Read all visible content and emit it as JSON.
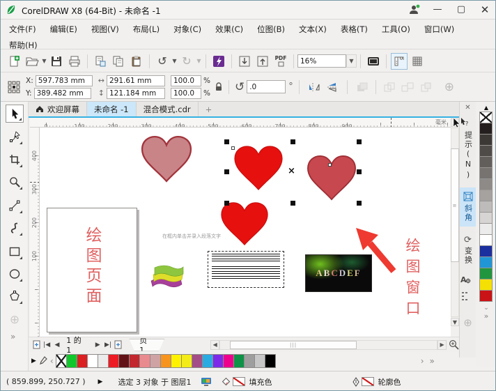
{
  "window": {
    "title": "CorelDRAW X8 (64-Bit) - 未命名 -1"
  },
  "menu": {
    "row1": [
      "文件(F)",
      "编辑(E)",
      "视图(V)",
      "布局(L)",
      "对象(C)",
      "效果(C)",
      "位图(B)",
      "文本(X)",
      "表格(T)",
      "工具(O)",
      "窗口(W)"
    ],
    "row2": [
      "帮助(H)"
    ]
  },
  "toolbar": {
    "zoom_value": "16%",
    "pdf": "PDF"
  },
  "props": {
    "x_label": "X:",
    "y_label": "Y:",
    "x": "597.783 mm",
    "y": "389.482 mm",
    "w": "291.61 mm",
    "h": "121.184 mm",
    "sx": "100.0",
    "sy": "100.0",
    "pct": "%",
    "angle": ".0",
    "deg": "°"
  },
  "tabs": {
    "items": [
      "欢迎屏幕",
      "未命名 -1",
      "混合模式.cdr"
    ],
    "new_tab": "+"
  },
  "ruler": {
    "h": [
      "0",
      "100",
      "200",
      "300",
      "400",
      "500",
      "600",
      "700",
      "800",
      "900"
    ],
    "unit": "毫米",
    "v": [
      "400",
      "300",
      "200",
      "100"
    ]
  },
  "canvas": {
    "page_text": "绘图页面",
    "window_text": "绘图窗口",
    "hint_text": "在框内单击并录入段落文字",
    "banner_text": "ABCDEF",
    "heart_colors": {
      "dusty": "#c98488",
      "bright": "#e6100f",
      "dark": "#c7484e"
    },
    "annotation_color": "#e06060"
  },
  "nav": {
    "pages": "1 的 1",
    "page_tab": "页 1"
  },
  "dockers": [
    {
      "label": "提示(N)",
      "active": false
    },
    {
      "label": "斜角",
      "active": true
    },
    {
      "label": "变换",
      "active": false
    }
  ],
  "palette_right": [
    "#241f1e",
    "#3c3836",
    "#4f4b49",
    "#625e5c",
    "#767371",
    "#8d8a88",
    "#a5a2a0",
    "#bebcba",
    "#d7d5d3",
    "#edecec",
    "#ffffff",
    "#1b2f9e",
    "#2196d6",
    "#22963f",
    "#f5e003",
    "#ca1317"
  ],
  "palette_bottom": [
    "#10c82c",
    "#da2021",
    "#ffffff",
    "#ebebeb",
    "#ed1c24",
    "#621216",
    "#c1272d",
    "#e98a8f",
    "#cfa3a4",
    "#f7941e",
    "#fff200",
    "#f3ec19",
    "#a34e86",
    "#29abe2",
    "#7d2ae8",
    "#ec008c",
    "#0e9247",
    "#9e9e9e",
    "#c7c7c7",
    "#000000"
  ],
  "status": {
    "coords": "( 859.899, 250.727 )",
    "selection": "选定 3 对象 于 图层1",
    "fill": "填充色",
    "outline": "轮廓色"
  }
}
